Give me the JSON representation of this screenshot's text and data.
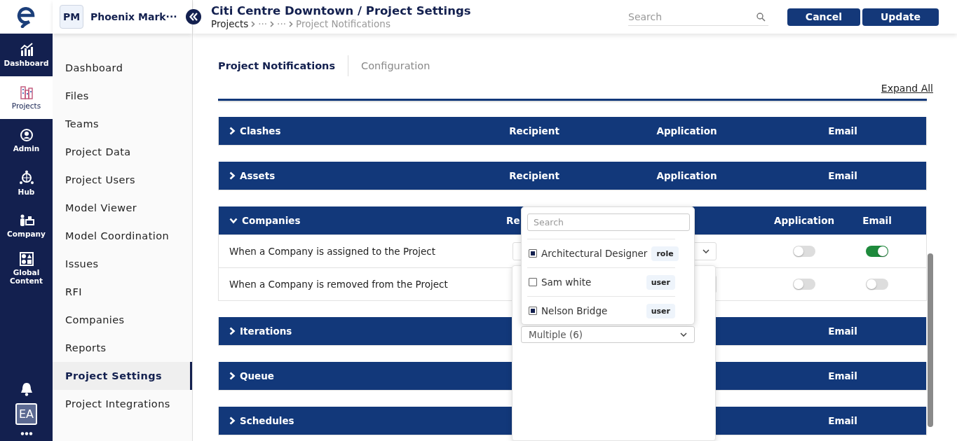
{
  "rail": {
    "items": [
      {
        "label": "Dashboard",
        "selected": false
      },
      {
        "label": "Projects",
        "selected": true
      },
      {
        "label": "Admin",
        "selected": false
      },
      {
        "label": "Hub",
        "selected": false
      },
      {
        "label": "Company",
        "selected": false
      },
      {
        "label": "Global Content",
        "selected": false
      }
    ],
    "avatar": "EA"
  },
  "project_switcher": {
    "initials": "PM",
    "name": "Phoenix Mark···"
  },
  "nav": {
    "items": [
      {
        "label": "Dashboard",
        "selected": false
      },
      {
        "label": "Files",
        "selected": false
      },
      {
        "label": "Teams",
        "selected": false
      },
      {
        "label": "Project Data",
        "selected": false
      },
      {
        "label": "Project Users",
        "selected": false
      },
      {
        "label": "Model Viewer",
        "selected": false
      },
      {
        "label": "Model Coordination",
        "selected": false
      },
      {
        "label": "Issues",
        "selected": false
      },
      {
        "label": "RFI",
        "selected": false
      },
      {
        "label": "Companies",
        "selected": false
      },
      {
        "label": "Reports",
        "selected": false
      },
      {
        "label": "Project Settings",
        "selected": true
      },
      {
        "label": "Project Integrations",
        "selected": false
      }
    ]
  },
  "header": {
    "title": "Citi Centre Downtown / Project Settings",
    "breadcrumb": [
      "Projects",
      "···",
      "···",
      "Project Notifications"
    ],
    "search": {
      "placeholder": "Search"
    },
    "buttons": [
      "Cancel",
      "Update"
    ]
  },
  "tabs": [
    {
      "label": "Project Notifications",
      "selected": true
    },
    {
      "label": "Configuration",
      "selected": false
    }
  ],
  "expand_all": "Expand All",
  "sections": [
    {
      "name": "Clashes",
      "expanded": false,
      "columns": [
        {
          "kind": "recipient",
          "label": "Recipient"
        },
        {
          "kind": "application",
          "label": "Application"
        },
        {
          "kind": "email",
          "label": "Email"
        }
      ]
    },
    {
      "name": "Assets",
      "expanded": false,
      "columns": [
        {
          "kind": "recipient",
          "label": "Recipient"
        },
        {
          "kind": "application",
          "label": "Application"
        },
        {
          "kind": "email",
          "label": "Email"
        }
      ]
    },
    {
      "name": "Companies",
      "expanded": true,
      "columns": [
        {
          "kind": "recipient",
          "label": "Re"
        },
        {
          "kind": "application",
          "label": "Application"
        },
        {
          "kind": "email",
          "label": "Email"
        }
      ],
      "rows": [
        {
          "label": "When a Company is assigned to the Project",
          "application_on": false,
          "email_on": true
        },
        {
          "label": "When a Company is removed from the Project",
          "application_on": false,
          "email_on": false
        }
      ]
    },
    {
      "name": "Iterations",
      "expanded": false,
      "columns": [
        {
          "kind": "email",
          "label": "Email"
        }
      ]
    },
    {
      "name": "Queue",
      "expanded": false,
      "columns": [
        {
          "kind": "email",
          "label": "Email"
        }
      ]
    },
    {
      "name": "Schedules",
      "expanded": false,
      "columns": [
        {
          "kind": "email",
          "label": "Email"
        }
      ]
    }
  ],
  "recipient_dropdown": {
    "search": {
      "placeholder": "Search"
    },
    "options": [
      {
        "label": "Architectural Designer",
        "tag": "role",
        "checked": true
      },
      {
        "label": "Sam white",
        "tag": "user",
        "checked": false
      },
      {
        "label": "Nelson Bridge",
        "tag": "user",
        "checked": true
      }
    ]
  },
  "recipient_select": {
    "value": "Multiple (6)"
  }
}
